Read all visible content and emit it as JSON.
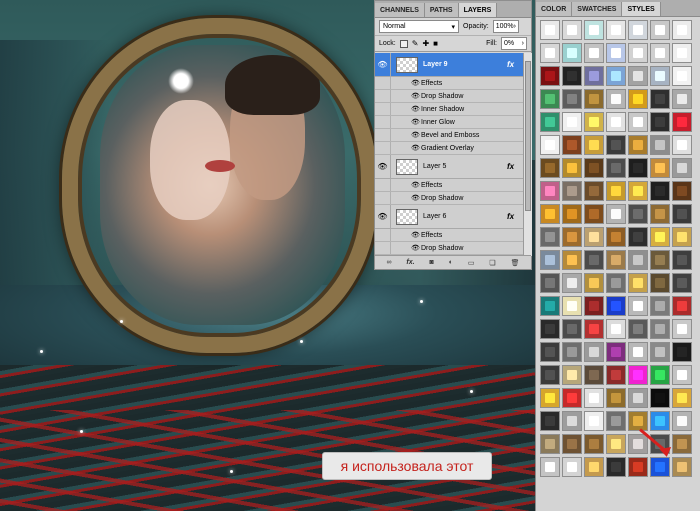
{
  "layers_panel": {
    "tabs": [
      "CHANNELS",
      "PATHS",
      "LAYERS"
    ],
    "active_tab": "LAYERS",
    "blend_mode": "Normal",
    "opacity_label": "Opacity:",
    "opacity_value": "100%",
    "lock_label": "Lock:",
    "fill_label": "Fill:",
    "fill_value": "0%",
    "layers": [
      {
        "name": "Layer 9",
        "selected": true,
        "fx": "fx",
        "effects_label": "Effects",
        "effects": [
          "Drop Shadow",
          "Inner Shadow",
          "Inner Glow",
          "Bevel and Emboss",
          "Gradient Overlay"
        ]
      },
      {
        "name": "Layer 5",
        "selected": false,
        "fx": "fx",
        "effects_label": "Effects",
        "effects": [
          "Drop Shadow"
        ]
      },
      {
        "name": "Layer 6",
        "selected": false,
        "fx": "fx",
        "effects_label": "Effects",
        "effects": [
          "Drop Shadow"
        ]
      }
    ],
    "footer_icons": [
      "link-icon",
      "fx-icon",
      "mask-icon",
      "adjustment-icon",
      "folder-icon",
      "new-layer-icon",
      "trash-icon"
    ]
  },
  "styles_panel": {
    "tabs": [
      "COLOR",
      "SWATCHES",
      "STYLES"
    ],
    "active_tab": "STYLES",
    "swatch_colors": [
      "#e9e9e9",
      "#d9d9d9",
      "#bfe3e0",
      "#e6e6e6",
      "#d1d6dc",
      "#c8c8c8",
      "#ececec",
      "#d6d6d6",
      "#9ad0cf",
      "#c2c2c2",
      "#b8c7e8",
      "#d2d2d2",
      "#cfcfcf",
      "#eeeeee",
      "#7a0f12",
      "#222222",
      "#6f6f9d",
      "#7ba4d6",
      "#a3a3a3",
      "#a7b3c2",
      "#f2f2f2",
      "#3b8a52",
      "#5d5d5d",
      "#8a6a2e",
      "#b4b4b4",
      "#d39b1a",
      "#2f2f2f",
      "#a8a8a8",
      "#2f8f6b",
      "#f0f0f0",
      "#d0b24a",
      "#e2e2e2",
      "#c8c8c8",
      "#2b2b2b",
      "#c61d2c",
      "#f0f0f0",
      "#7c3f1e",
      "#c79d3a",
      "#3b3b3b",
      "#a87c2d",
      "#8d8d8d",
      "#e0e0e0",
      "#6b4b1f",
      "#b38a2b",
      "#5a3a1a",
      "#4c4c4c",
      "#1e1e1e",
      "#c28b3b",
      "#9a9a9a",
      "#c0608a",
      "#7b6f64",
      "#6a4b2a",
      "#c69a2b",
      "#d4a739",
      "#1f1f1f",
      "#5a3518",
      "#c88923",
      "#a06a1a",
      "#7d4c1d",
      "#b4b4b4",
      "#4d4d4d",
      "#8d6a33",
      "#3a3a3a",
      "#6a6a6a",
      "#9c6b2d",
      "#bba070",
      "#8c5c24",
      "#2e2e2e",
      "#d6ae3f",
      "#c5a14e",
      "#7a8a9c",
      "#b58a3a",
      "#4b4b4b",
      "#9a7a4a",
      "#8f8f8f",
      "#6b5a3a",
      "#3e3e3e",
      "#555555",
      "#a9a9a9",
      "#b18f3e",
      "#6e6e6e",
      "#c4a04a",
      "#5b4a2e",
      "#404040",
      "#1a7a78",
      "#e8e0b0",
      "#7a2020",
      "#1a3cc8",
      "#b9b9b9",
      "#7b7b7b",
      "#aa2b2b",
      "#2a2a2a",
      "#4b4b4b",
      "#b03030",
      "#dcdcdc",
      "#5a5a5a",
      "#7d7d7d",
      "#c9c9c9",
      "#3c3c3c",
      "#6e6e6e",
      "#9a9a9a",
      "#7d2d7d",
      "#b8b8b8",
      "#8a8a8a",
      "#1a1a1a",
      "#3a3a3a",
      "#b7a77a",
      "#5a4a3a",
      "#8a2a2a",
      "#f022d0",
      "#27a445",
      "#c3c3c3",
      "#d6a62b",
      "#c52a2a",
      "#e1e1e1",
      "#8c6b2b",
      "#9c9c9c",
      "#0c0c0c",
      "#d8a63a",
      "#2a2a2a",
      "#9d9d9d",
      "#eeeeee",
      "#6e6e6e",
      "#a27d2f",
      "#2b8be8",
      "#b3b3b3",
      "#8a7a5a",
      "#6e5233",
      "#7b5a2e",
      "#c8a65c",
      "#a29e9e",
      "#4a4a4a",
      "#8a6a3a",
      "#c4c4c4",
      "#d4d4d4",
      "#c49a4e",
      "#2a2a2a",
      "#9a2a1a",
      "#1a52d8",
      "#a98a52"
    ]
  },
  "caption": {
    "text": "я использовала этот"
  }
}
